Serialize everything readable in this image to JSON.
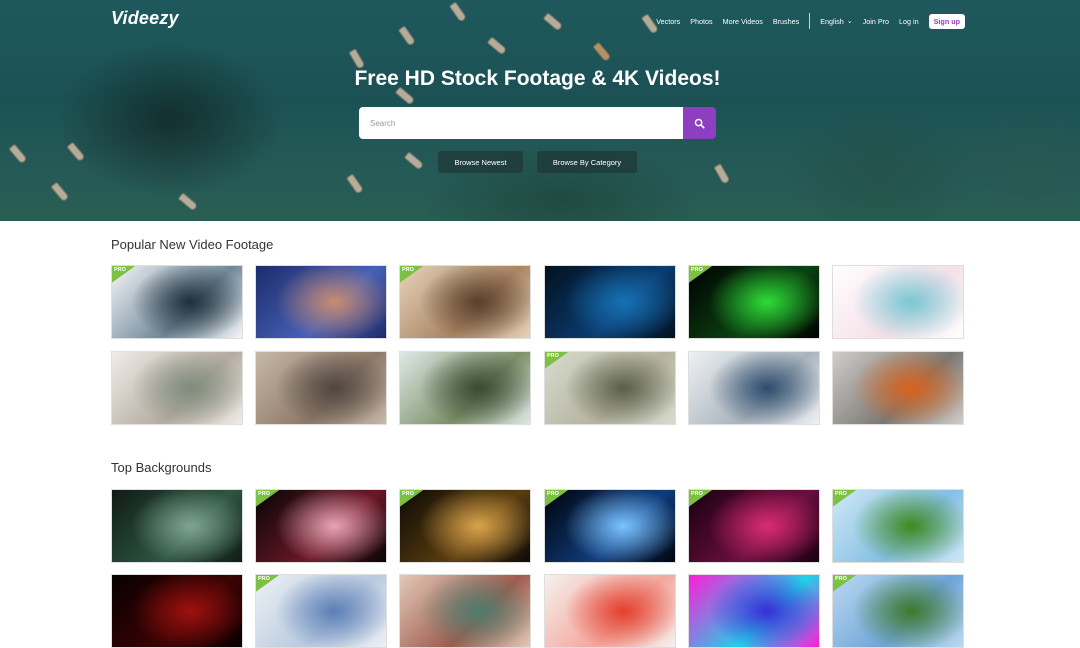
{
  "header": {
    "logo": "Videezy",
    "nav": {
      "vectors": "Vectors",
      "photos": "Photos",
      "more_videos": "More Videos",
      "brushes": "Brushes",
      "language": "English",
      "join_pro": "Join Pro",
      "login": "Log in",
      "signup": "Sign up"
    }
  },
  "hero": {
    "title": "Free HD Stock Footage & 4K Videos!",
    "search_placeholder": "Search",
    "browse_newest": "Browse Newest",
    "browse_category": "Browse By Category"
  },
  "sections": [
    {
      "title": "Popular New Video Footage",
      "items": [
        {
          "pro": true,
          "icon": "scientist-microscope-thumbnail",
          "colors": [
            "#f4f6f8",
            "#6f8798",
            "#1f2f3c"
          ]
        },
        {
          "pro": false,
          "icon": "lab-test-tube-thumbnail",
          "colors": [
            "#1c2c6a",
            "#4661b8",
            "#c98a70"
          ]
        },
        {
          "pro": true,
          "icon": "lab-workers-thumbnail",
          "colors": [
            "#e7d3ba",
            "#a88463",
            "#5a3f2a"
          ]
        },
        {
          "pro": false,
          "icon": "virus-cells-thumbnail",
          "colors": [
            "#02111f",
            "#0b3d72",
            "#1671b4"
          ]
        },
        {
          "pro": true,
          "icon": "green-virus-thumbnail",
          "colors": [
            "#000000",
            "#0b4311",
            "#2edb38"
          ]
        },
        {
          "pro": false,
          "icon": "online-shopping-illustration-thumbnail",
          "colors": [
            "#ffffff",
            "#f5dfe8",
            "#79c7d3"
          ]
        },
        {
          "pro": false,
          "icon": "laptop-typing-thumbnail",
          "colors": [
            "#f0ede6",
            "#b4aba2",
            "#7f8b7c"
          ]
        },
        {
          "pro": false,
          "icon": "man-on-sofa-phone-thumbnail",
          "colors": [
            "#c7b8a7",
            "#8e7868",
            "#4f4741"
          ]
        },
        {
          "pro": false,
          "icon": "woman-working-window-thumbnail",
          "colors": [
            "#dfe8e6",
            "#7b8f68",
            "#3b4a34"
          ]
        },
        {
          "pro": true,
          "icon": "woman-mask-thumbs-up-thumbnail",
          "colors": [
            "#d7dccf",
            "#b5b39f",
            "#5a5f4a"
          ]
        },
        {
          "pro": false,
          "icon": "stressed-man-laptop-thumbnail",
          "colors": [
            "#eef1f3",
            "#a9b3bd",
            "#2d4c6d"
          ]
        },
        {
          "pro": false,
          "icon": "cleaning-glove-thumbnail",
          "colors": [
            "#cfcdc9",
            "#7a7874",
            "#d8631c"
          ]
        }
      ]
    },
    {
      "title": "Top Backgrounds",
      "items": [
        {
          "pro": false,
          "icon": "green-maze-thumbnail",
          "colors": [
            "#101b16",
            "#2d5642",
            "#7fa590"
          ]
        },
        {
          "pro": true,
          "icon": "bokeh-lights-thumbnail",
          "colors": [
            "#050505",
            "#6d1726",
            "#e7a5b5"
          ]
        },
        {
          "pro": true,
          "icon": "golden-particles-thumbnail",
          "colors": [
            "#0c0a05",
            "#5b3d10",
            "#d9a34b"
          ]
        },
        {
          "pro": true,
          "icon": "earth-from-space-thumbnail",
          "colors": [
            "#01030c",
            "#0f3d7c",
            "#7bc3ff"
          ]
        },
        {
          "pro": true,
          "icon": "magenta-shards-thumbnail",
          "colors": [
            "#180010",
            "#6a0f3e",
            "#d82b73"
          ]
        },
        {
          "pro": true,
          "icon": "sunny-meadow-thumbnail",
          "colors": [
            "#cfe8f7",
            "#84bfe4",
            "#3f8a1f"
          ]
        },
        {
          "pro": false,
          "icon": "red-particles-thumbnail",
          "colors": [
            "#080000",
            "#3c0303",
            "#9e1010"
          ]
        },
        {
          "pro": true,
          "icon": "map-pins-thumbnail",
          "colors": [
            "#eef1f5",
            "#b8c9df",
            "#5c7fb6"
          ]
        },
        {
          "pro": false,
          "icon": "kaleidoscope-thumbnail",
          "colors": [
            "#e2c9b8",
            "#9e5b4e",
            "#4f7c6d"
          ]
        },
        {
          "pro": false,
          "icon": "red-ink-smoke-thumbnail",
          "colors": [
            "#f6f1ed",
            "#f3a69d",
            "#e3402f"
          ]
        },
        {
          "pro": false,
          "icon": "neon-blobs-thumbnail",
          "colors": [
            "#ff1cd7",
            "#20d2e8",
            "#3b2bd6"
          ]
        },
        {
          "pro": true,
          "icon": "trees-sky-thumbnail",
          "colors": [
            "#bcd9f1",
            "#6ea4d8",
            "#3f7a2b"
          ]
        }
      ]
    }
  ],
  "pro_badge": "PRO",
  "accent_color": "#8e3ec0",
  "pro_badge_color": "#7cc143"
}
